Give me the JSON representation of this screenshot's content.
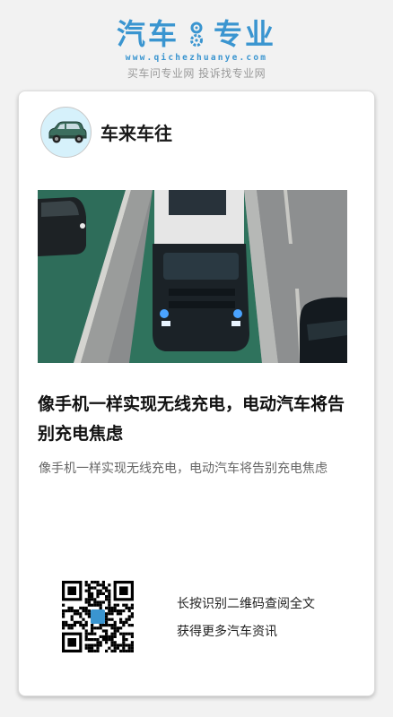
{
  "site": {
    "logo_left": "汽车",
    "logo_right": "专业",
    "url": "www.qichezhuanye.com",
    "slogan": "买车问专业网 投诉找专业网",
    "brand_color": "#3a95d0"
  },
  "author": {
    "name": "车来车往",
    "avatar_icon": "car-icon"
  },
  "article": {
    "hero_image_icon": "highway-truck-image",
    "title": "像手机一样实现无线充电，电动汽车将告别充电焦虑",
    "summary": "像手机一样实现无线充电，电动汽车将告别充电焦虑"
  },
  "qr": {
    "icon": "qr-code-icon",
    "line1": "长按识别二维码查阅全文",
    "line2": "获得更多汽车资讯"
  }
}
